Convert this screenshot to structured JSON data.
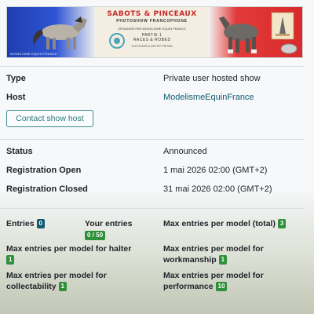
{
  "banner": {
    "title": "SABOTS & PINCEAUX",
    "subtitle": "PHOTOSHOW FRANCOPHONE",
    "organizer": "ORGANISÉ PAR MODELISME EQUIN FRANCE",
    "part": "PARTIE 1",
    "races": "RACES & ROBES",
    "small": "CUSTOMS & ARTIST RESIN",
    "corner_text": "MODELISME EQUIN FRANCE",
    "colors": {
      "blue": "#2f55d4",
      "red": "#d92a2a",
      "cream": "#f4ede2"
    }
  },
  "info": {
    "type_label": "Type",
    "type_value": "Private user hosted show",
    "host_label": "Host",
    "host_value": "ModelismeEquinFrance",
    "contact_button": "Contact show host",
    "status_label": "Status",
    "status_value": "Announced",
    "reg_open_label": "Registration Open",
    "reg_open_value": "1 mai 2026 02:00 (GMT+2)",
    "reg_closed_label": "Registration Closed",
    "reg_closed_value": "31 mai 2026 02:00 (GMT+2)"
  },
  "stats": {
    "entries_label": "Entries",
    "entries_value": "0",
    "your_entries_label": "Your entries",
    "your_entries_value": "0 / 50",
    "max_total_label": "Max entries per model (total)",
    "max_total_value": "3",
    "max_halter_label_1": "Max entries per model for halter",
    "max_halter_value": "1",
    "max_workmanship_label_1": "Max entries per model for",
    "max_workmanship_label_2": "workmanship",
    "max_workmanship_value": "1",
    "max_collectability_label_1": "Max entries per model for",
    "max_collectability_label_2": "collectability",
    "max_collectability_value": "1",
    "max_performance_label_1": "Max entries per model for",
    "max_performance_label_2": "performance",
    "max_performance_value": "10"
  },
  "icons": [
    "horse-icon",
    "stamp-icon",
    "logo-icon"
  ]
}
